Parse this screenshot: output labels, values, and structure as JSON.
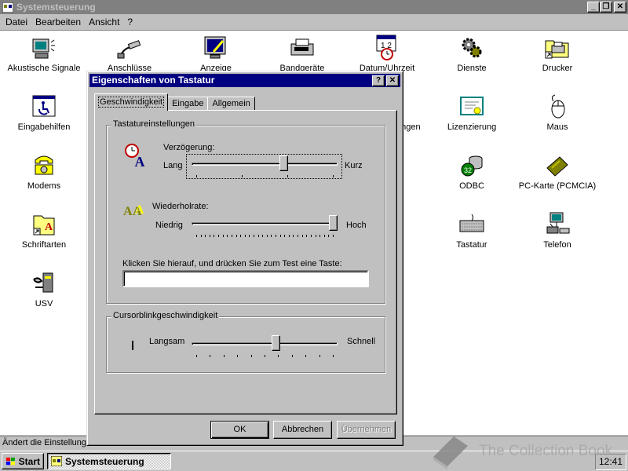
{
  "window": {
    "title": "Systemsteuerung",
    "menu": [
      "Datei",
      "Bearbeiten",
      "Ansicht",
      "?"
    ]
  },
  "icons": [
    {
      "label": "Akustische Signale",
      "icon": "speaker-icon"
    },
    {
      "label": "Anschlüsse",
      "icon": "connector-icon"
    },
    {
      "label": "Anzeige",
      "icon": "display-icon"
    },
    {
      "label": "Bandgeräte",
      "icon": "tape-drive-icon"
    },
    {
      "label": "Datum/Uhrzeit",
      "icon": "calendar-clock-icon"
    },
    {
      "label": "Dienste",
      "icon": "gears-icon"
    },
    {
      "label": "Drucker",
      "icon": "printer-folder-icon"
    },
    {
      "label": "Eingabehilfen",
      "icon": "accessibility-icon"
    },
    {
      "label": "…ungen",
      "icon": "hidden-icon"
    },
    {
      "label": "Lizenzierung",
      "icon": "certificate-icon"
    },
    {
      "label": "Maus",
      "icon": "mouse-icon"
    },
    {
      "label": "Modems",
      "icon": "modem-phone-icon"
    },
    {
      "label": "ODBC",
      "icon": "database-icon"
    },
    {
      "label": "PC-Karte (PCMCIA)",
      "icon": "pc-card-icon"
    },
    {
      "label": "Schriftarten",
      "icon": "fonts-folder-icon"
    },
    {
      "label": "Tastatur",
      "icon": "keyboard-icon"
    },
    {
      "label": "Telefon",
      "icon": "telephony-icon"
    },
    {
      "label": "USV",
      "icon": "ups-icon"
    }
  ],
  "status": {
    "text": "Ändert die Einstellunge"
  },
  "taskbar": {
    "start_label": "Start",
    "task_label": "Systemsteuerung",
    "clock": "12:41"
  },
  "watermark": {
    "text": "The Collection Book"
  },
  "dialog": {
    "title": "Eigenschaften von Tastatur",
    "tabs": [
      "Geschwindigkeit",
      "Eingabe",
      "Allgemein"
    ],
    "group_keyboard": "Tastatureinstellungen",
    "delay_label": "Verzögerung:",
    "delay_min": "Lang",
    "delay_max": "Kurz",
    "delay_level": 0.64,
    "repeat_label": "Wiederholrate:",
    "repeat_min": "Niedrig",
    "repeat_max": "Hoch",
    "repeat_level": 1.0,
    "test_prompt": "Klicken Sie hierauf, und drücken Sie zum Test eine Taste:",
    "test_value": "",
    "group_cursor": "Cursorblinkgeschwindigkeit",
    "blink_min": "Langsam",
    "blink_max": "Schnell",
    "blink_level": 0.58,
    "ok_label": "OK",
    "cancel_label": "Abbrechen",
    "apply_label": "Übernehmen"
  }
}
